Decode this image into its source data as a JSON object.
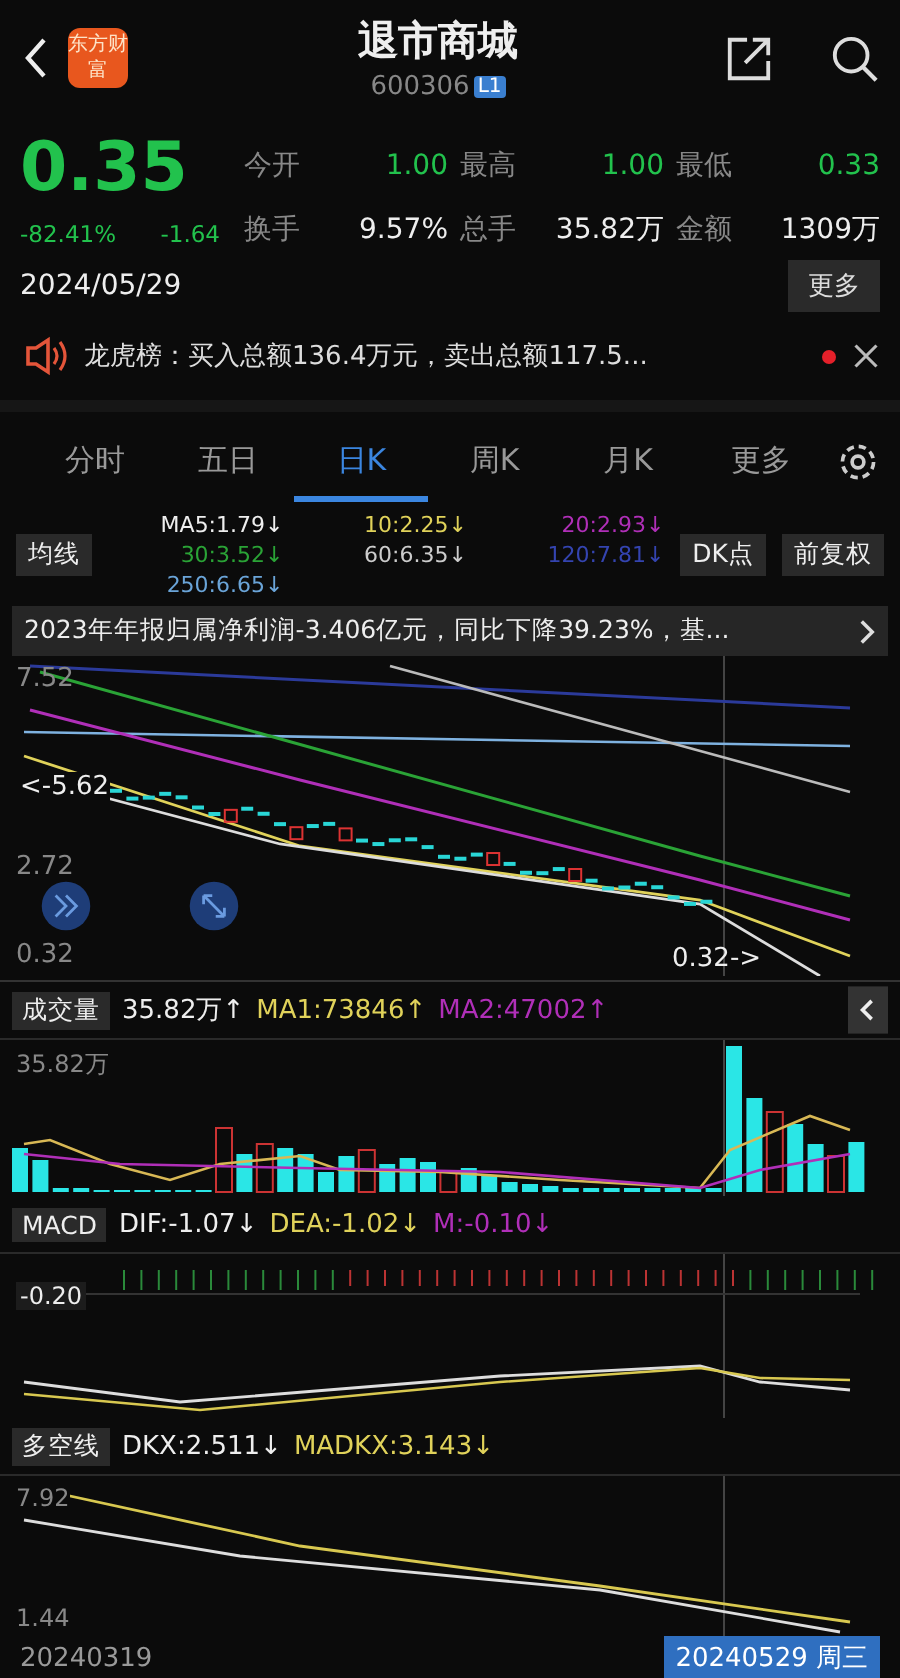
{
  "header": {
    "logo_text": "东方财富",
    "title": "退市商城",
    "code": "600306",
    "level_badge": "L1"
  },
  "quote": {
    "price": "0.35",
    "change_pct": "-82.41%",
    "change": "-1.64",
    "date": "2024/05/29",
    "more_button": "更多",
    "stats": [
      {
        "label": "今开",
        "value": "1.00",
        "color": "#22c24d"
      },
      {
        "label": "最高",
        "value": "1.00",
        "color": "#22c24d"
      },
      {
        "label": "最低",
        "value": "0.33",
        "color": "#22c24d"
      },
      {
        "label": "换手",
        "value": "9.57%",
        "color": "#eeeeee"
      },
      {
        "label": "总手",
        "value": "35.82万",
        "color": "#eeeeee"
      },
      {
        "label": "金额",
        "value": "1309万",
        "color": "#eeeeee"
      }
    ]
  },
  "notice": {
    "text": "龙虎榜：买入总额136.4万元，卖出总额117.5...",
    "unread": true
  },
  "tabs": [
    {
      "label": "分时",
      "selected": false
    },
    {
      "label": "五日",
      "selected": false
    },
    {
      "label": "日K",
      "selected": true
    },
    {
      "label": "周K",
      "selected": false
    },
    {
      "label": "月K",
      "selected": false
    },
    {
      "label": "更多",
      "selected": false
    }
  ],
  "ma_selector": "均线",
  "ma_legend": [
    {
      "text": "MA5:1.79↓",
      "color": "#eeeeee"
    },
    {
      "text": "10:2.25↓",
      "color": "#e0d25a"
    },
    {
      "text": "20:2.93↓",
      "color": "#b02fb8"
    },
    {
      "text": "30:3.52↓",
      "color": "#2aa336"
    },
    {
      "text": "60:6.35↓",
      "color": "#cccccc"
    },
    {
      "text": "120:7.81↓",
      "color": "#3444b0"
    },
    {
      "text": "250:6.65↓",
      "color": "#6aa4d8"
    }
  ],
  "dk_button": "DK点",
  "adjust_button": "前复权",
  "news": "2023年年报归属净利润-3.406亿元，同比下降39.23%，基...",
  "kline": {
    "axis_labels": [
      "7.52",
      "2.72",
      "0.32"
    ],
    "high_marker": "<-5.62",
    "low_marker": "0.32->"
  },
  "panels": [
    {
      "selector": "成交量",
      "legend": [
        {
          "text": "35.82万↑",
          "color": "#eeeeee"
        },
        {
          "text": "MA1:73846↑",
          "color": "#e0d25a"
        },
        {
          "text": "MA2:47002↑",
          "color": "#b02fb8"
        }
      ],
      "axis_labels": [
        "35.82万"
      ],
      "kind": "volume"
    },
    {
      "selector": "MACD",
      "legend": [
        {
          "text": "DIF:-1.07↓",
          "color": "#eeeeee"
        },
        {
          "text": "DEA:-1.02↓",
          "color": "#e0d25a"
        },
        {
          "text": "M:-0.10↓",
          "color": "#b02fb8"
        }
      ],
      "axis_labels": [
        "-0.20"
      ],
      "kind": "macd"
    },
    {
      "selector": "多空线",
      "legend": [
        {
          "text": "DKX:2.511↓",
          "color": "#eeeeee"
        },
        {
          "text": "MADKX:3.143↓",
          "color": "#e0d25a"
        }
      ],
      "axis_labels": [
        "7.92",
        "1.44"
      ],
      "kind": "dkx"
    }
  ],
  "footer": {
    "start_date": "20240319",
    "cursor_date": "20240529 周三"
  }
}
